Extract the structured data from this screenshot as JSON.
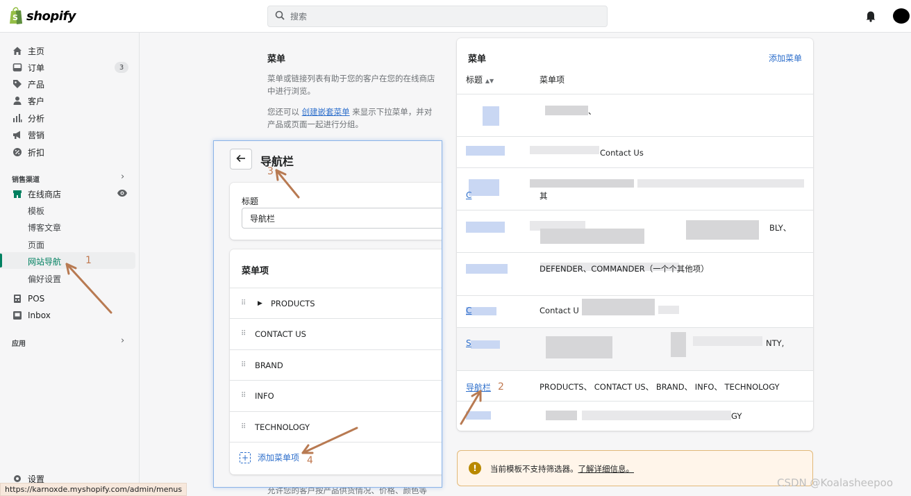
{
  "brand": {
    "name": "shopify",
    "color": "#95bf47"
  },
  "search": {
    "placeholder": "搜索"
  },
  "sidebar": {
    "items": [
      {
        "label": "主页",
        "icon": "home-icon"
      },
      {
        "label": "订单",
        "icon": "orders-icon",
        "badge": "3"
      },
      {
        "label": "产品",
        "icon": "tag-icon"
      },
      {
        "label": "客户",
        "icon": "person-icon"
      },
      {
        "label": "分析",
        "icon": "bar-chart-icon"
      },
      {
        "label": "营销",
        "icon": "megaphone-icon"
      },
      {
        "label": "折扣",
        "icon": "discount-icon"
      }
    ],
    "sales_channels_label": "销售渠道",
    "online_store": {
      "label": "在线商店",
      "icon": "store-icon"
    },
    "sub_items": [
      "模板",
      "博客文章",
      "页面",
      "网站导航",
      "偏好设置"
    ],
    "pos": {
      "label": "POS",
      "icon": "pos-icon"
    },
    "inbox": {
      "label": "Inbox",
      "icon": "inbox-icon"
    },
    "apps_label": "应用",
    "settings": {
      "label": "设置",
      "icon": "gear-icon"
    },
    "active_color": "#008060"
  },
  "status_url": "https://karnoxde.myshopify.com/admin/menus",
  "description": {
    "title": "菜单",
    "p1": "菜单或链接列表有助于您的客户在您的在线商店中进行浏览。",
    "p2_prefix": "您还可以 ",
    "p2_link": "创建嵌套菜单",
    "p2_suffix": " 来显示下拉菜单，并对产品或页面一起进行分组。",
    "p3": "允许您的客户按产品供货情况、价格、颜色等"
  },
  "menus_card": {
    "title": "菜单",
    "add_label": "添加菜单",
    "col_title": "标题",
    "col_items": "菜单项",
    "rows": [
      {
        "link": "",
        "items": "、"
      },
      {
        "link": "",
        "items": "Contact Us"
      },
      {
        "link": "C",
        "items": "其"
      },
      {
        "link": "",
        "items": "BLY、"
      },
      {
        "link": "",
        "items": "DEFENDER、COMMANDER（一个个其他项）"
      },
      {
        "link": "C",
        "items": "Contact U"
      },
      {
        "link": "S",
        "items": "NTY,"
      },
      {
        "link": "导航栏",
        "items": "PRODUCTS、 CONTACT US、 BRAND、 INFO、 TECHNOLOGY"
      },
      {
        "link": "",
        "items": "GY"
      }
    ]
  },
  "banner": {
    "text": "当前模板不支持筛选器。",
    "link": "了解详细信息。",
    "icon": "warning-icon"
  },
  "nav_panel": {
    "title": "导航栏",
    "field_label": "标题",
    "field_value": "导航栏",
    "items_title": "菜单项",
    "items": [
      "PRODUCTS",
      "CONTACT US",
      "BRAND",
      "INFO",
      "TECHNOLOGY"
    ],
    "add_item_label": "添加菜单项"
  },
  "annotations": [
    "1",
    "2",
    "3",
    "4"
  ],
  "watermark": "CSDN @Koalasheepoo",
  "annotation_color": "#c0784f"
}
